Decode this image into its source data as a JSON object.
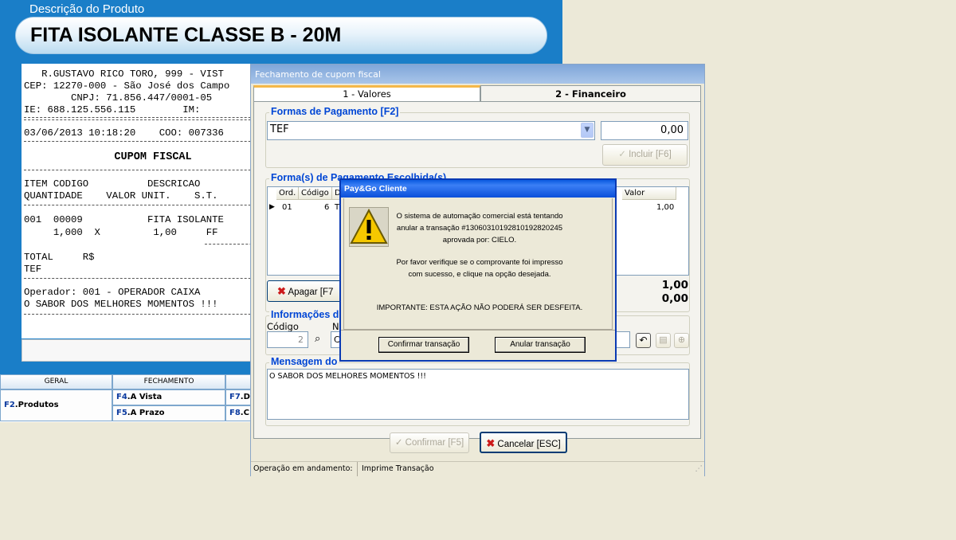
{
  "pos": {
    "product_caption": "Descrição do Produto",
    "product_name": "FITA ISOLANTE CLASSE B - 20M",
    "receipt_lines": [
      "   R.GUSTAVO RICO TORO, 999 - VIST",
      "CEP: 12270-000 - São José dos Campo",
      "        CNPJ: 71.856.447/0001-05",
      "IE: 688.125.556.115        IM:",
      "03/06/2013 10:18:20    COO: 007336",
      "              CUPOM FISCAL",
      "ITEM CODIGO          DESCRICAO",
      "QUANTIDADE    VALOR UNIT.    S.T.",
      "001  00009           FITA ISOLANTE",
      "     1,000  X         1,00     FF",
      "TOTAL     R$",
      "TEF",
      "Operador: 001 - OPERADOR CAIXA",
      "O SABOR DOS MELHORES MOMENTOS !!!"
    ],
    "fkeys": {
      "headers": [
        "GERAL",
        "FECHAMENTO"
      ],
      "produtos": {
        "key": "F2",
        "label": ".Produtos"
      },
      "a_vista": {
        "key": "F4",
        "label": ".A Vista"
      },
      "a_prazo": {
        "key": "F5",
        "label": ".A Prazo"
      },
      "f7": {
        "key": "F7",
        "label": ".D"
      },
      "f8": {
        "key": "F8",
        "label": ".C"
      }
    }
  },
  "fechamento": {
    "title": "Fechamento de cupom fiscal",
    "tabs": [
      "1 - Valores",
      "2 - Financeiro"
    ],
    "formas_title": "Formas de Pagamento [F2]",
    "forma_selected": "TEF",
    "valor": "0,00",
    "incluir_label": "Incluir [F6]",
    "escolhidas_title": "Forma(s) de Pagamento Escolhida(s)",
    "grid_headers": [
      "Ord.",
      "Código",
      "D",
      "Valor"
    ],
    "grid_row": {
      "ord": "01",
      "codigo": "6",
      "desc": "T",
      "valor": "1,00"
    },
    "apagar_label": "Apagar [F7",
    "total_1": "1,00",
    "total_2": "0,00",
    "info_title": "Informações d",
    "codigo_label": "Código",
    "codigo_value": "2",
    "n_label": "N",
    "n_value": "C",
    "mensagem_title": "Mensagem do",
    "mensagem_text": "O SABOR DOS MELHORES MOMENTOS !!!",
    "confirmar_label": "Confirmar [F5]",
    "cancelar_label": "Cancelar [ESC]",
    "status_label": "Operação em andamento:",
    "status_value": "Imprime Transação"
  },
  "paygo": {
    "title": "Pay&Go Cliente",
    "msg1": "O sistema de automação comercial está tentando",
    "msg2": "anular a transação #13060310192810192820245",
    "msg3": "aprovada por: CIELO.",
    "msg4": "Por favor verifique se o comprovante foi impresso",
    "msg5": "com sucesso, e clique na opção desejada.",
    "msg6": "IMPORTANTE: ESTA AÇÃO NÃO PODERÁ SER DESFEITA.",
    "confirm_label": "Confirmar transação",
    "anular_label": "Anular transação"
  },
  "colors": {
    "pos_blue": "#1a7ec8",
    "group_title": "#0046d5",
    "modal_title": "#0a5ae0",
    "cancel_icon": "#cc1a1a"
  }
}
